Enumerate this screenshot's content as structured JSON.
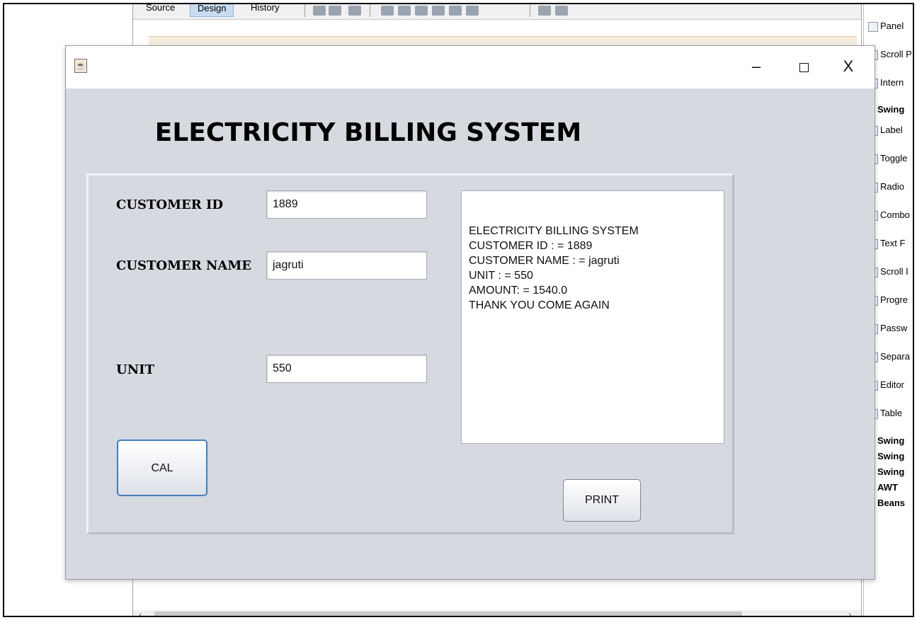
{
  "ide": {
    "tabs": [
      "Source",
      "Design",
      "History"
    ],
    "palette_items": [
      {
        "label": "Panel",
        "icon": "panel-icon"
      },
      {
        "label": "Scroll P",
        "icon": "scroll-pane-icon"
      },
      {
        "label": "Intern",
        "icon": "internal-frame-icon"
      }
    ],
    "palette_category_open": "Swing",
    "swing_controls": [
      {
        "label": "Label",
        "icon": "label-icon"
      },
      {
        "label": "Toggle",
        "icon": "toggle-button-icon"
      },
      {
        "label": "Radio",
        "icon": "radio-button-icon"
      },
      {
        "label": "Combo",
        "icon": "combo-box-icon"
      },
      {
        "label": "Text F",
        "icon": "text-field-icon"
      },
      {
        "label": "Scroll I",
        "icon": "scroll-icon"
      },
      {
        "label": "Progre",
        "icon": "progress-bar-icon"
      },
      {
        "label": "Passw",
        "icon": "password-field-icon"
      },
      {
        "label": "Separa",
        "icon": "separator-icon"
      },
      {
        "label": "Editor",
        "icon": "editor-pane-icon"
      },
      {
        "label": "Table",
        "icon": "table-icon"
      }
    ],
    "collapsed_categories": [
      "Swing",
      "Swing",
      "Swing",
      "AWT",
      "Beans"
    ]
  },
  "window": {
    "minimize_glyph": "–",
    "close_glyph": "X"
  },
  "app": {
    "title": "ELECTRICITY BILLING SYSTEM",
    "customer_id_label": "CUSTOMER ID",
    "customer_id_value": "1889",
    "customer_name_label": "CUSTOMER NAME",
    "customer_name_value": "jagruti",
    "unit_label": "UNIT",
    "unit_value": "550",
    "cal_button": "CAL",
    "print_button": "PRINT",
    "receipt_lines": [
      "ELECTRICITY BILLING SYSTEM",
      "",
      "CUSTOMER ID : = 1889",
      "CUSTOMER NAME : = jagruti",
      "UNIT : = 550",
      "AMOUNT: = 1540.0",
      "THANK YOU COME AGAIN"
    ]
  }
}
